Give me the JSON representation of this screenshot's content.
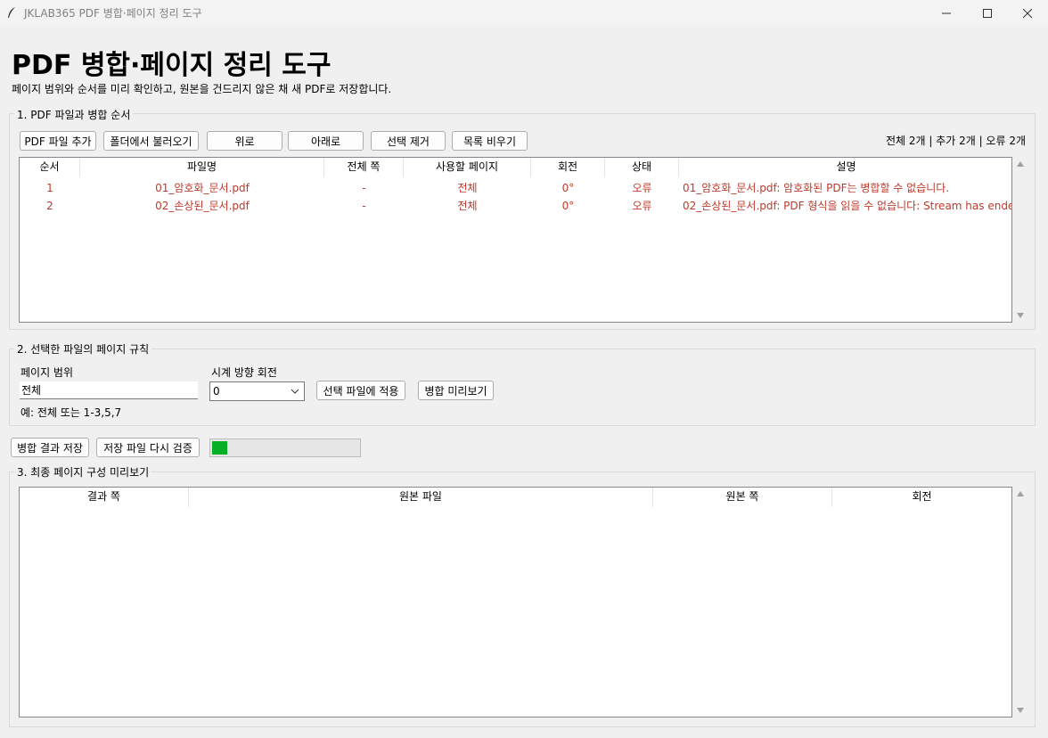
{
  "window": {
    "title": "JKLAB365 PDF 병합·페이지 정리 도구"
  },
  "header": {
    "title": "PDF 병합·페이지 정리 도구",
    "subtitle": "페이지 범위와 순서를 미리 확인하고, 원본을 건드리지 않은 채 새 PDF로 저장합니다."
  },
  "section1": {
    "label": "1. PDF 파일과 병합 순서",
    "buttons": {
      "add_pdf": "PDF 파일 추가",
      "load_folder": "폴더에서 불러오기",
      "move_up": "위로",
      "move_down": "아래로",
      "remove_selected": "선택 제거",
      "clear_list": "목록 비우기"
    },
    "counts": "전체 2개 | 추가 2개 | 오류 2개",
    "columns": [
      "순서",
      "파일명",
      "전체 쪽",
      "사용할 페이지",
      "회전",
      "상태",
      "설명"
    ],
    "rows": [
      [
        "1",
        "01_암호화_문서.pdf",
        "-",
        "전체",
        "0°",
        "오류",
        "01_암호화_문서.pdf: 암호화된 PDF는 병합할 수 없습니다."
      ],
      [
        "2",
        "02_손상된_문서.pdf",
        "-",
        "전체",
        "0°",
        "오류",
        "02_손상된_문서.pdf: PDF 형식을 읽을 수 없습니다: Stream has ende"
      ]
    ],
    "error_color": "#c0392b"
  },
  "section2": {
    "label": "2. 선택한 파일의 페이지 규칙",
    "page_range_label": "페이지 범위",
    "page_range_value": "전체",
    "example": "예: 전체 또는 1-3,5,7",
    "rotation_label": "시계 방향 회전",
    "rotation_value": "0",
    "apply_button": "선택 파일에 적용",
    "preview_button": "병합 미리보기"
  },
  "actions": {
    "save_button": "병합 결과 저장",
    "verify_button": "저장 파일 다시 검증",
    "progress": 0.1,
    "progress_color": "#06b025"
  },
  "section3": {
    "label": "3. 최종 페이지 구성 미리보기",
    "columns": [
      "결과 쪽",
      "원본 파일",
      "원본 쪽",
      "회전"
    ]
  }
}
